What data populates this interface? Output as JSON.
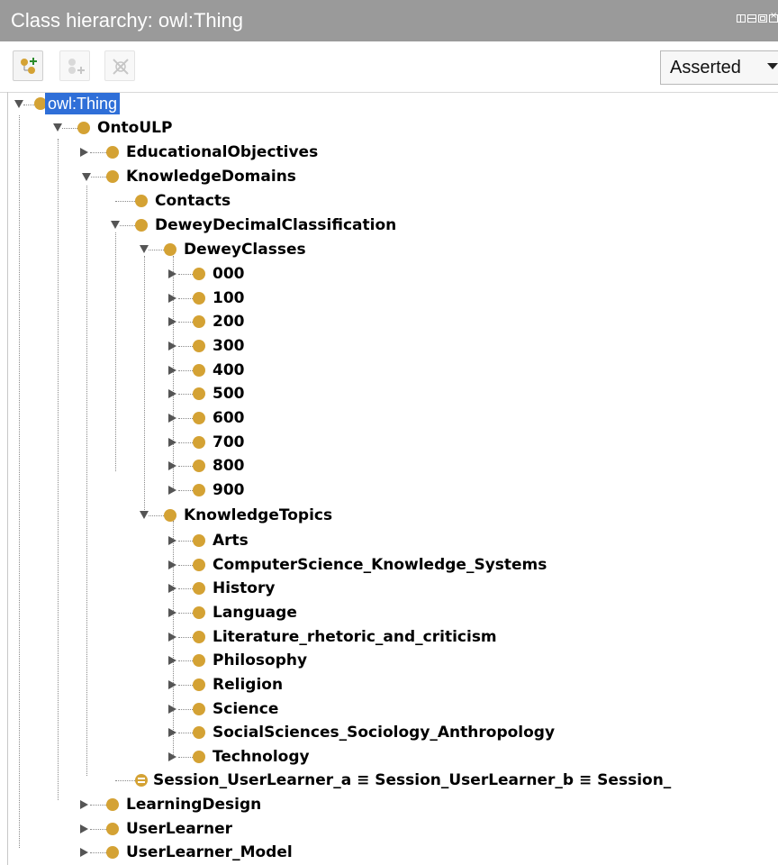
{
  "panel": {
    "title": "Class hierarchy: owl:Thing"
  },
  "toolbar": {
    "buttons": [
      {
        "icon": "add-subclass-icon"
      },
      {
        "icon": "add-sibling-icon"
      },
      {
        "icon": "delete-class-icon"
      }
    ],
    "view_mode": "Asserted"
  },
  "tree": {
    "root": "owl:Thing",
    "ontology": "OntoULP",
    "educational_objectives": "EducationalObjectives",
    "knowledge_domains": "KnowledgeDomains",
    "contacts": "Contacts",
    "ddc": "DeweyDecimalClassification",
    "dewey_classes": "DeweyClasses",
    "classes": [
      "000",
      "100",
      "200",
      "300",
      "400",
      "500",
      "600",
      "700",
      "800",
      "900"
    ],
    "knowledge_topics": "KnowledgeTopics",
    "topics": [
      "Arts",
      "ComputerScience_Knowledge_Systems",
      "History",
      "Language",
      "Literature_rhetoric_and_criticism",
      "Philosophy",
      "Religion",
      "Science",
      "SocialSciences_Sociology_Anthropology",
      "Technology"
    ],
    "session": "Session_UserLearner_a ≡ Session_UserLearner_b ≡ Session_",
    "learning_design": "LearningDesign",
    "user_learner": "UserLearner",
    "user_learner_model": "UserLearner_Model"
  },
  "colors": {
    "class_dot": "#d4a234",
    "selection": "#2f6fd8",
    "titlebar": "#9a9a9a"
  }
}
